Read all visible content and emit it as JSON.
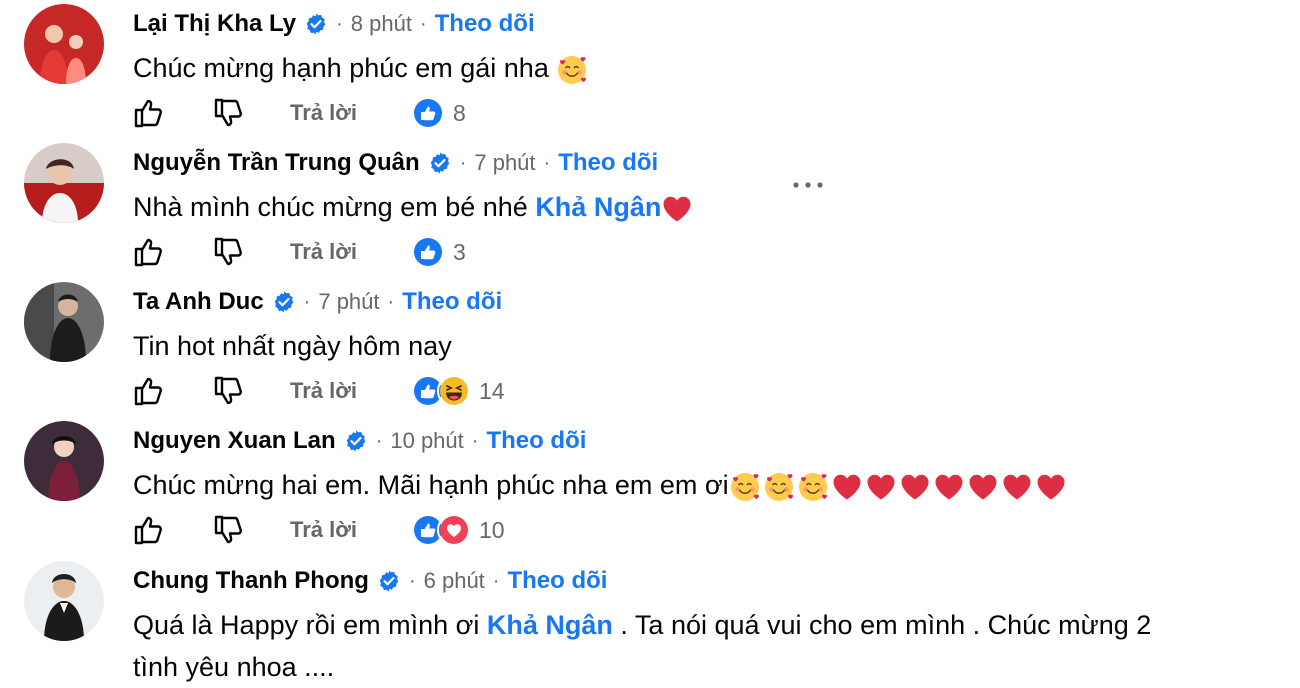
{
  "comments": [
    {
      "name": "Lại Thị Kha Ly",
      "time": "8 phút",
      "follow": "Theo dõi",
      "text": "Chúc mừng hạnh phúc em gái nha",
      "reply": "Trả lời",
      "reaction_count": "8",
      "avatar_color": "#c62828"
    },
    {
      "name": "Nguyễn Trần Trung Quân",
      "time": "7 phút",
      "follow": "Theo dõi",
      "text": "Nhà mình chúc mừng em bé nhé",
      "mention": "Khả Ngân",
      "reply": "Trả lời",
      "reaction_count": "3",
      "avatar_color": "#8d6e63"
    },
    {
      "name": "Ta Anh Duc",
      "time": "7 phút",
      "follow": "Theo dõi",
      "text": "Tin hot nhất ngày hôm nay",
      "reply": "Trả lời",
      "reaction_count": "14",
      "avatar_color": "#424242"
    },
    {
      "name": "Nguyen Xuan Lan",
      "time": "10 phút",
      "follow": "Theo dõi",
      "text": "Chúc mừng hai em. Mãi hạnh phúc nha em em ơi",
      "reply": "Trả lời",
      "reaction_count": "10",
      "avatar_color": "#3e2c3a"
    },
    {
      "name": "Chung Thanh Phong",
      "time": "6 phút",
      "follow": "Theo dõi",
      "text_before": "Quá là Happy rồi em mình ơi",
      "mention": "Khả Ngân",
      "text_after": ". Ta nói quá vui cho em mình . Chúc mừng 2",
      "text_line2": "tình yêu nhoa ....",
      "avatar_color": "#263238"
    }
  ],
  "colors": {
    "brand": "#1877f2",
    "secondary_text": "#65676b",
    "like_blue": "#1877f2",
    "heart_red": "#f33e58"
  },
  "icons": [
    "verified-badge-icon",
    "thumbs-up-icon",
    "thumbs-down-icon",
    "like-reaction-icon",
    "haha-reaction-icon",
    "love-reaction-icon",
    "smiling-face-with-hearts-emoji",
    "red-heart-emoji",
    "more-options-icon"
  ]
}
